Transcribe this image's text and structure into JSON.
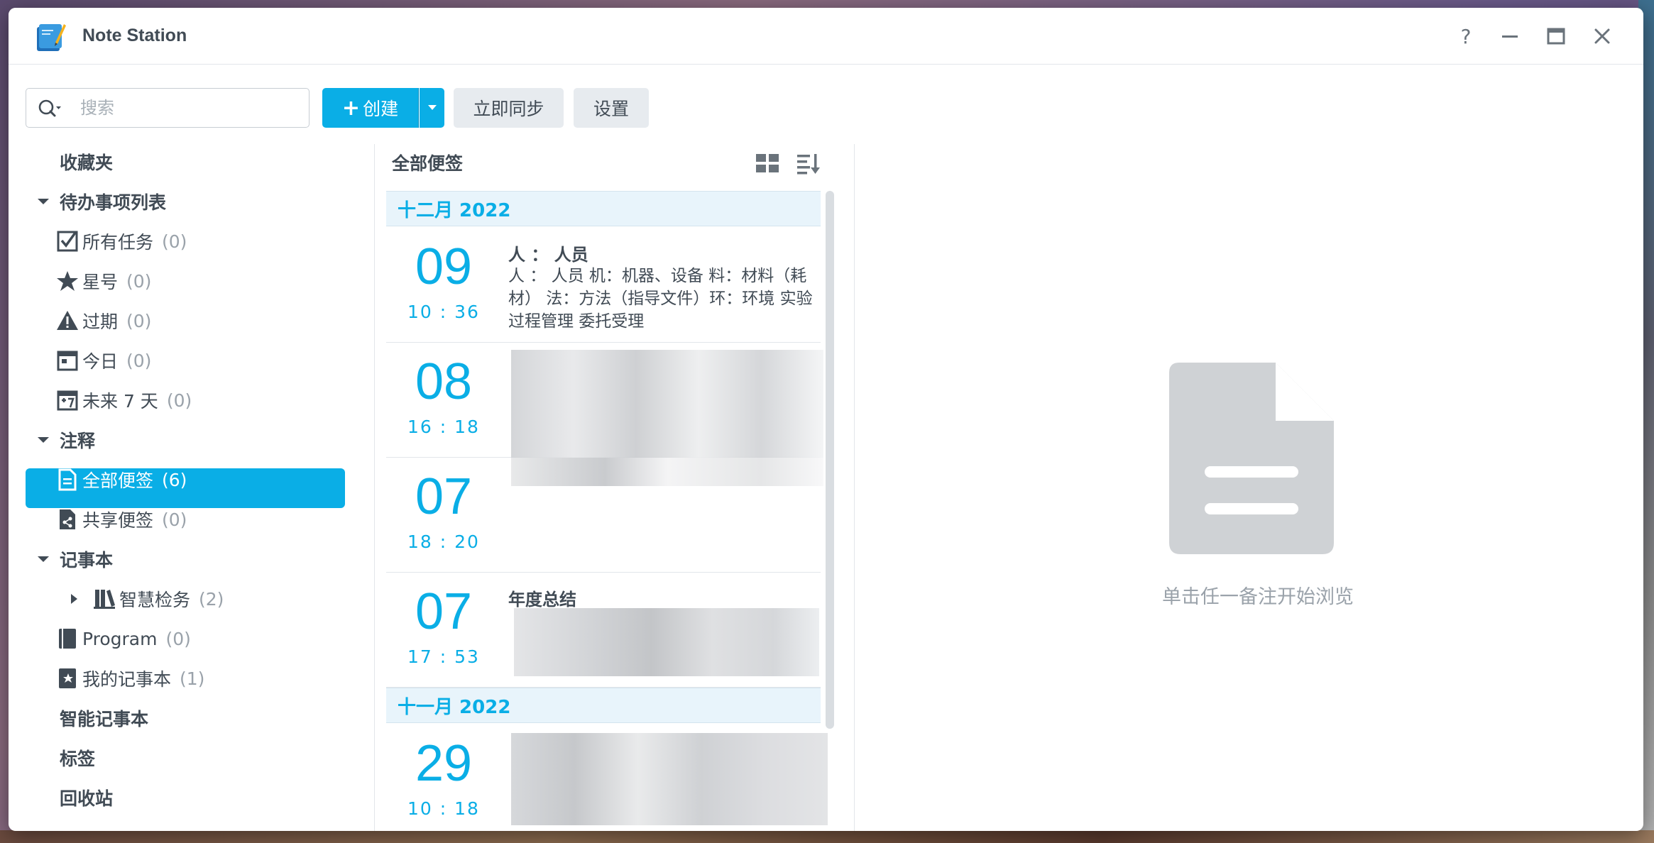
{
  "window": {
    "title": "Note Station",
    "controls": {
      "help": "?",
      "minimize": "—",
      "maximize": "▭",
      "close": "✕"
    }
  },
  "toolbar": {
    "search_placeholder": "搜索",
    "create_label": "创建",
    "create_plus": "+",
    "sync_label": "立即同步",
    "settings_label": "设置"
  },
  "sidebar": {
    "favorites": "收藏夹",
    "todo_group": "待办事项列表",
    "todo_items": [
      {
        "label": "所有任务",
        "count": "(0)",
        "icon": "checkbox-icon"
      },
      {
        "label": "星号",
        "count": "(0)",
        "icon": "star-icon"
      },
      {
        "label": "过期",
        "count": "(0)",
        "icon": "warning-icon"
      },
      {
        "label": "今日",
        "count": "(0)",
        "icon": "calendar-icon"
      },
      {
        "label": "未来 7 天",
        "count": "(0)",
        "icon": "calendar-week-icon"
      }
    ],
    "notes_group": "注释",
    "notes_items": [
      {
        "label": "全部便签",
        "count": "(6)",
        "icon": "note-icon"
      },
      {
        "label": "共享便签",
        "count": "(0)",
        "icon": "shared-note-icon"
      }
    ],
    "notebook_group": "记事本",
    "notebook_items": [
      {
        "label": "智慧检务",
        "count": "(2)",
        "icon": "notebook-stack-icon"
      },
      {
        "label": "Program",
        "count": "(0)",
        "icon": "notebook-icon"
      },
      {
        "label": "我的记事本",
        "count": "(1)",
        "icon": "notebook-star-icon"
      }
    ],
    "smart_notebook": "智能记事本",
    "tags": "标签",
    "trash": "回收站"
  },
  "note_list": {
    "title": "全部便签",
    "months": [
      {
        "label": "十二月 2022"
      },
      {
        "label": "十一月 2022"
      }
    ],
    "notes": [
      {
        "day": "09",
        "time": "10 : 36",
        "title": "人 ： 人员",
        "body": "人 ： 人员 机：机器、设备 料：材料（耗材） 法：方法（指导文件）环：环境 实验过程管理 委托受理"
      },
      {
        "day": "08",
        "time": "16 : 18",
        "title": "",
        "body": ""
      },
      {
        "day": "07",
        "time": "18 : 20",
        "title": "",
        "body": ""
      },
      {
        "day": "07",
        "time": "17 : 53",
        "title": "年度总结",
        "body": ""
      },
      {
        "day": "29",
        "time": "10 : 18",
        "title": "",
        "body": ""
      }
    ]
  },
  "viewer": {
    "empty_text": "单击任一备注开始浏览",
    "icon": "document-icon"
  },
  "colors": {
    "accent": "#0aaee6",
    "text": "#414b55",
    "muted": "#9aa2aa",
    "month_bg": "#e8f4fb"
  }
}
